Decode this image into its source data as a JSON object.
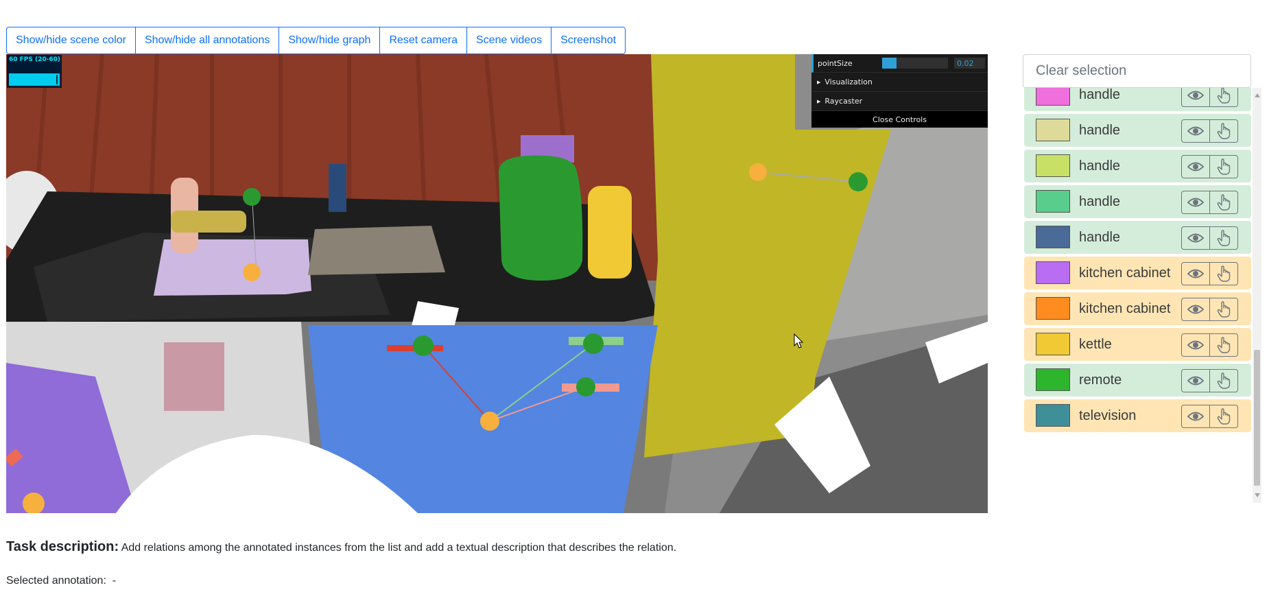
{
  "toolbar": {
    "buttons": [
      {
        "label": "Show/hide scene color"
      },
      {
        "label": "Show/hide all annotations"
      },
      {
        "label": "Show/hide graph"
      },
      {
        "label": "Reset camera"
      },
      {
        "label": "Scene videos"
      },
      {
        "label": "Screenshot"
      }
    ]
  },
  "viewer": {
    "fps_label": "60 FPS (20-60)",
    "gui": {
      "point_size_label": "pointSize",
      "point_size_value": "0.02",
      "point_size_fill_fraction": 0.22,
      "visualization_label": "Visualization",
      "raycaster_label": "Raycaster",
      "close_controls_label": "Close Controls"
    }
  },
  "selection": {
    "placeholder": "Clear selection"
  },
  "annotations": {
    "items": [
      {
        "label": "handle",
        "color": "#ef6fdd",
        "status": "green"
      },
      {
        "label": "handle",
        "color": "#dedb9a",
        "status": "green"
      },
      {
        "label": "handle",
        "color": "#c8e065",
        "status": "green"
      },
      {
        "label": "handle",
        "color": "#58cd8c",
        "status": "green"
      },
      {
        "label": "handle",
        "color": "#4a6a97",
        "status": "green"
      },
      {
        "label": "kitchen cabinet",
        "color": "#b96df2",
        "status": "orange"
      },
      {
        "label": "kitchen cabinet",
        "color": "#ff8c1f",
        "status": "orange"
      },
      {
        "label": "kettle",
        "color": "#f0c934",
        "status": "orange"
      },
      {
        "label": "remote",
        "color": "#2db52d",
        "status": "green"
      },
      {
        "label": "television",
        "color": "#3f8f98",
        "status": "orange"
      }
    ],
    "row_icons": [
      "eye-icon",
      "hand-pointer-icon"
    ]
  },
  "task": {
    "heading": "Task description:",
    "text": "Add relations among the annotated instances from the list and add a textual description that describes the relation."
  },
  "selected_annotation": {
    "label": "Selected annotation:",
    "value": "-"
  }
}
